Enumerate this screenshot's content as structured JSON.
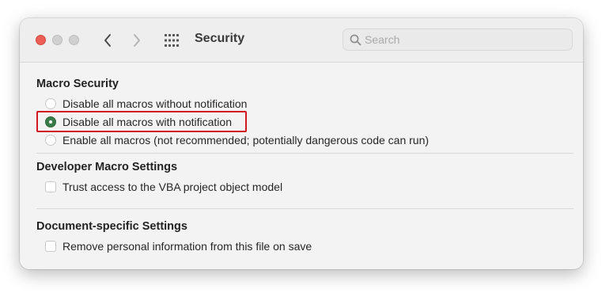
{
  "window": {
    "title": "Security"
  },
  "search": {
    "placeholder": "Search",
    "value": ""
  },
  "sections": {
    "macro_security": {
      "heading": "Macro Security",
      "options": [
        {
          "label": "Disable all macros without notification",
          "selected": false
        },
        {
          "label": "Disable all macros with notification",
          "selected": true
        },
        {
          "label": "Enable all macros (not recommended; potentially dangerous code can run)",
          "selected": false
        }
      ]
    },
    "developer": {
      "heading": "Developer Macro Settings",
      "checkbox_label": "Trust access to the VBA project object model",
      "checked": false
    },
    "document": {
      "heading": "Document-specific Settings",
      "checkbox_label": "Remove personal information from this file on save",
      "checked": false
    }
  },
  "icons": {
    "close": "close-icon",
    "minimize": "minimize-icon",
    "zoom": "zoom-icon",
    "back": "chevron-left-icon",
    "forward": "chevron-right-icon",
    "show_all": "grid-icon",
    "search": "search-icon"
  },
  "colors": {
    "close_button": "#ec5f57",
    "radio_selected": "#3b7a49",
    "highlight_border": "#d0181e",
    "window_background": "#f4f3f3"
  }
}
